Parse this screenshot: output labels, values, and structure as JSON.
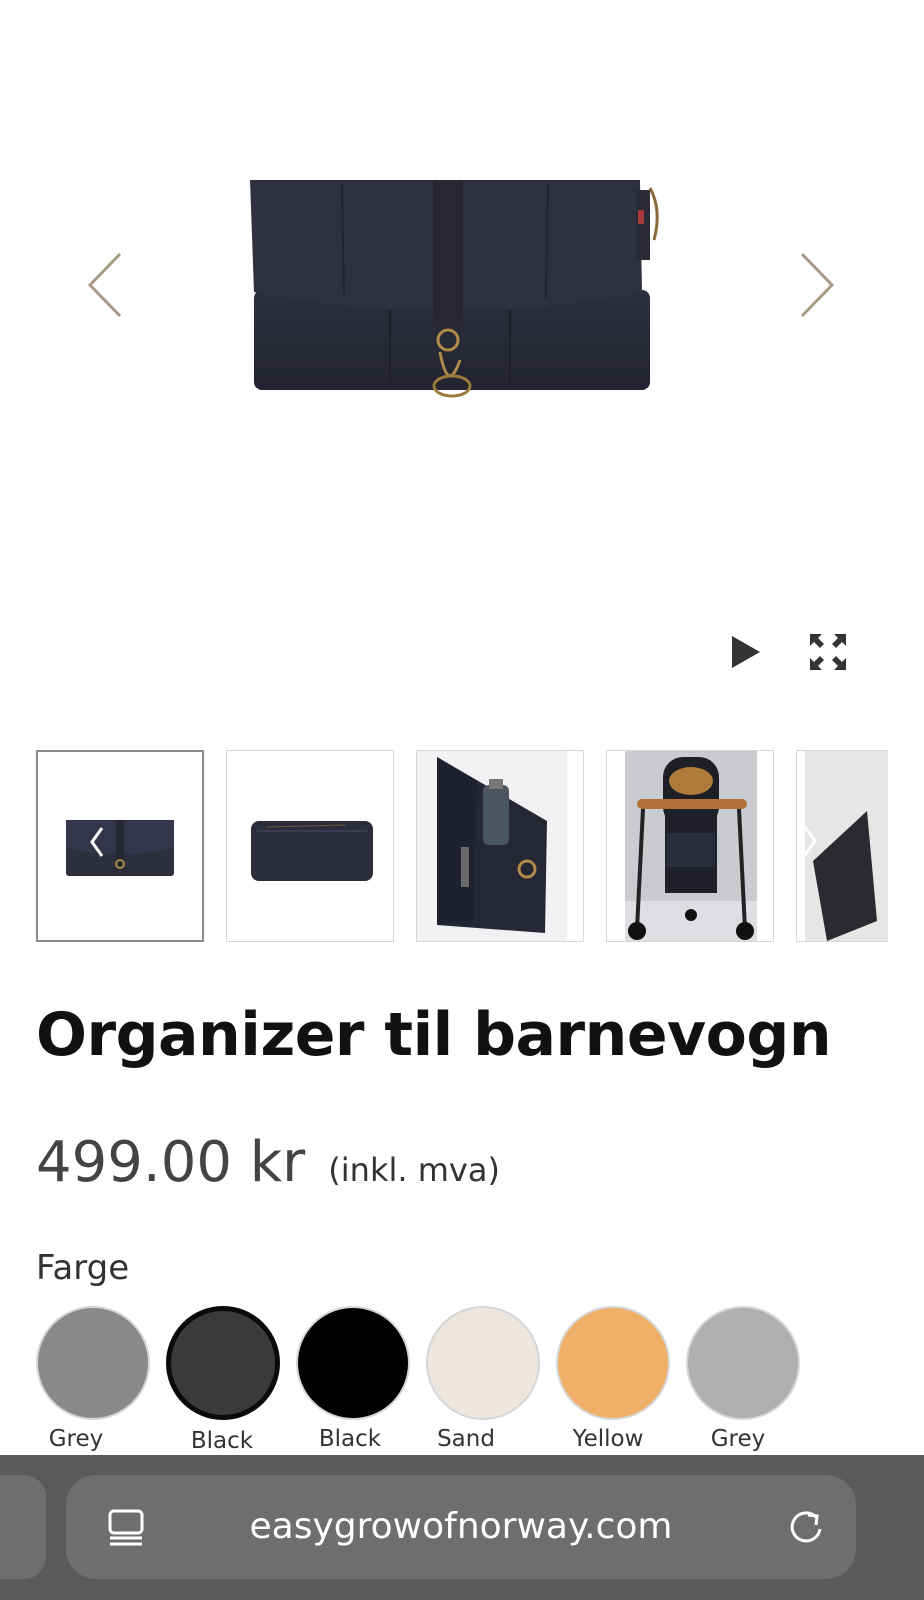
{
  "gallery": {
    "prev_icon": "chevron-left-icon",
    "next_icon": "chevron-right-icon",
    "play_icon": "play-icon",
    "fullscreen_icon": "expand-icon",
    "thumbnails": [
      {
        "alt": "organizer front"
      },
      {
        "alt": "organizer back"
      },
      {
        "alt": "organizer with bottle"
      },
      {
        "alt": "organizer on stroller"
      },
      {
        "alt": "organizer detail"
      }
    ]
  },
  "product": {
    "title": "Organizer til barnevogn",
    "price": "499.00 kr",
    "vat_note": "(inkl. mva)",
    "color_label": "Farge",
    "colors": [
      {
        "name": "Grey",
        "hex": "#8a8a8a"
      },
      {
        "name": "Black",
        "hex": "#3a3a3a"
      },
      {
        "name": "Black",
        "hex": "#000000"
      },
      {
        "name": "Sand",
        "hex": "#ece6df"
      },
      {
        "name": "Yellow",
        "hex": "#f1b06a"
      },
      {
        "name": "Grey",
        "hex": "#b0b0b0"
      }
    ],
    "selected_color_index": 1
  },
  "browser": {
    "url": "easygrowofnorway.com",
    "reader_icon": "reader-mode-icon",
    "reload_icon": "reload-icon"
  },
  "colors": {
    "arrow": "#a89a86",
    "bag": "#2b2d3a",
    "browser_bar": "#5a5a5a"
  }
}
